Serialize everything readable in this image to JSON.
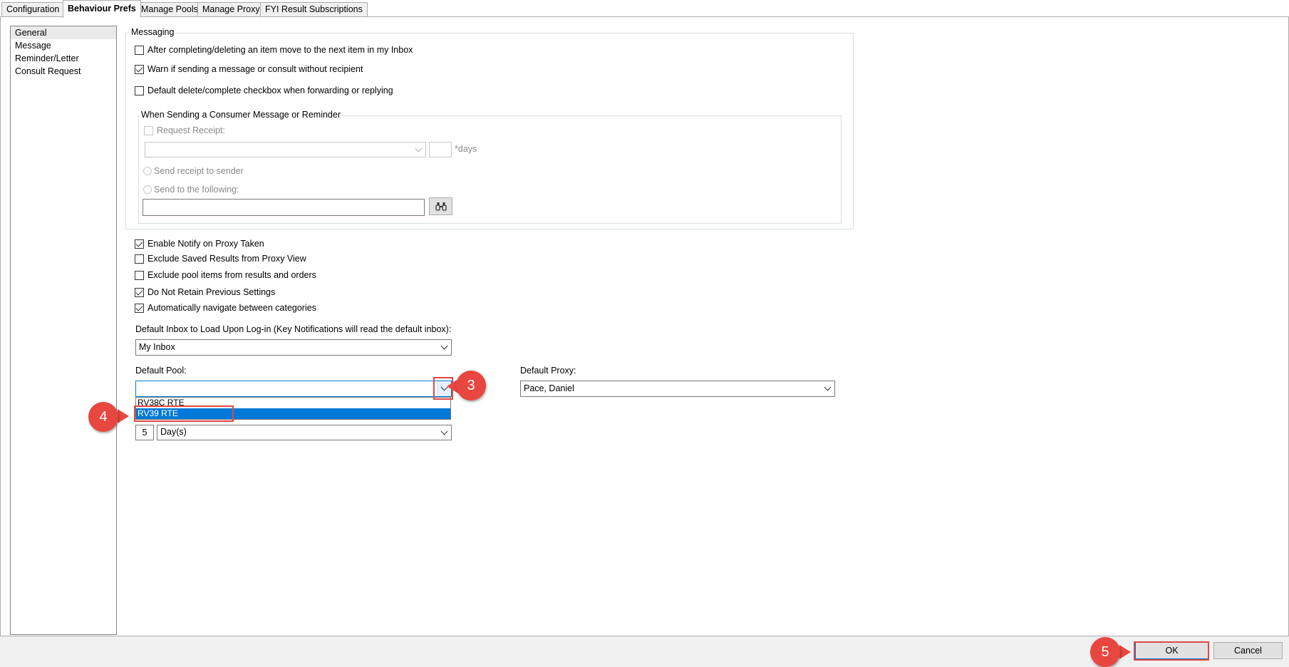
{
  "tabs": [
    "Configuration",
    "Behaviour Prefs",
    "Manage Pools",
    "Manage Proxy",
    "FYI Result Subscriptions"
  ],
  "nav": [
    "General",
    "Message",
    "Reminder/Letter",
    "Consult Request"
  ],
  "messaging": {
    "label": "Messaging",
    "opt_move_next": "After completing/deleting an item move to the next item in my Inbox",
    "opt_warn_no_recipient": "Warn if sending a message or consult without recipient",
    "opt_default_delete": "Default delete/complete checkbox when forwarding or replying"
  },
  "consumer": {
    "label": "When Sending a Consumer Message or Reminder",
    "request_receipt": "Request Receipt:",
    "days_label": "*days",
    "send_to_sender": "Send receipt to sender",
    "send_to_following": "Send to the following:"
  },
  "options": {
    "notify_proxy": "Enable Notify on Proxy Taken",
    "exclude_saved": "Exclude Saved Results from Proxy View",
    "exclude_pool": "Exclude pool items from results and orders",
    "no_retain": "Do Not Retain Previous Settings",
    "auto_nav": "Automatically navigate between categories"
  },
  "inbox": {
    "label": "Default Inbox to Load Upon Log-in (Key Notifications will read the default inbox):",
    "value": "My Inbox"
  },
  "pool": {
    "label": "Default Pool:",
    "value": "",
    "options": [
      "RV38C RTE",
      "RV39 RTE"
    ]
  },
  "proxy": {
    "label": "Default Proxy:",
    "value": "Pace, Daniel"
  },
  "retention": {
    "count": "5",
    "unit": "Day(s)"
  },
  "buttons": {
    "ok": "OK",
    "cancel": "Cancel"
  },
  "callouts": [
    "3",
    "4",
    "5"
  ],
  "colors": {
    "accent": "#0078d7",
    "callout": "#e8473f"
  }
}
